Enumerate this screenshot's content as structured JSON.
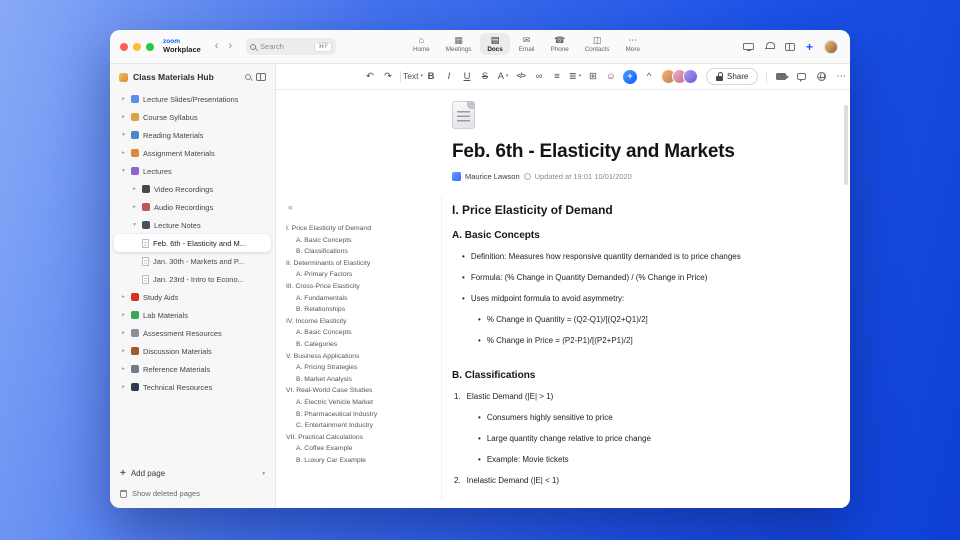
{
  "icons": {
    "back": "‹",
    "forward": "›",
    "home_tab": "⌂",
    "meetings_tab": "▦",
    "docs_tab": "▤",
    "email_tab": "✉",
    "phone_tab": "☎",
    "contacts_tab": "◫",
    "more_tab": "⋯",
    "undo": "↶",
    "redo": "↷",
    "bold": "B",
    "italic": "I",
    "underline": "U",
    "strikethrough": "S",
    "text_color": "A",
    "code": "</>",
    "link": "∞",
    "bulleted_list": "≡",
    "align": "≣",
    "table": "⊞",
    "emoji": "☺",
    "chevron_down": "▾",
    "chevron_up": "^",
    "collapse_outline": "«",
    "more": "⋯",
    "add": "+",
    "plus_new": "+",
    "bullet": "•",
    "tree_expanded": "▾",
    "tree_collapsed": "▸"
  },
  "header": {
    "brand_top": "zoom",
    "brand_bottom": "Workplace",
    "search_label": "Search",
    "search_shortcut": "⌘F",
    "tabs": [
      {
        "id": "home",
        "label": "Home",
        "active": false
      },
      {
        "id": "meetings",
        "label": "Meetings",
        "active": false
      },
      {
        "id": "docs",
        "label": "Docs",
        "active": true
      },
      {
        "id": "email",
        "label": "Email",
        "active": false
      },
      {
        "id": "phone",
        "label": "Phone",
        "active": false
      },
      {
        "id": "contacts",
        "label": "Contacts",
        "active": false
      },
      {
        "id": "more",
        "label": "More",
        "active": false
      }
    ]
  },
  "sidebar": {
    "title": "Class Materials Hub",
    "items": [
      {
        "label": "Lecture Slides/Presentations",
        "level": 0,
        "state": "collapsed",
        "color": "#5b8def"
      },
      {
        "label": "Course Syllabus",
        "level": 0,
        "state": "collapsed",
        "color": "#d9a441"
      },
      {
        "label": "Reading Materials",
        "level": 0,
        "state": "expanded",
        "color": "#4c86c6"
      },
      {
        "label": "Assignment Materials",
        "level": 0,
        "state": "collapsed",
        "color": "#d8893b"
      },
      {
        "label": "Lectures",
        "level": 0,
        "state": "expanded",
        "color": "#8e63ce"
      },
      {
        "label": "Video Recordings",
        "level": 1,
        "state": "collapsed",
        "color": "#45484d"
      },
      {
        "label": "Audio Recordings",
        "level": 1,
        "state": "collapsed",
        "color": "#c0574f"
      },
      {
        "label": "Lecture Notes",
        "level": 1,
        "state": "expanded",
        "color": "#46525e"
      },
      {
        "label": "Feb. 6th - Elasticity and M...",
        "level": 2,
        "state": "page",
        "selected": true
      },
      {
        "label": "Jan. 30th - Markets and P...",
        "level": 2,
        "state": "page",
        "selected": false
      },
      {
        "label": "Jan. 23rd - Intro to Econo...",
        "level": 2,
        "state": "page",
        "selected": false
      },
      {
        "label": "Study Aids",
        "level": 0,
        "state": "collapsed",
        "color": "#d93025"
      },
      {
        "label": "Lab Materials",
        "level": 0,
        "state": "collapsed",
        "color": "#3aa757"
      },
      {
        "label": "Assessment Resources",
        "level": 0,
        "state": "collapsed",
        "color": "#8a8f98"
      },
      {
        "label": "Discussion Materials",
        "level": 0,
        "state": "collapsed",
        "color": "#a05a2c"
      },
      {
        "label": "Reference Materials",
        "level": 0,
        "state": "collapsed",
        "color": "#6d7b8d"
      },
      {
        "label": "Technical Resources",
        "level": 0,
        "state": "collapsed",
        "color": "#2f3b4c"
      }
    ],
    "add_page_label": "Add page",
    "show_deleted_label": "Show deleted pages"
  },
  "toolbar": {
    "text_style_label": "Text",
    "share_label": "Share"
  },
  "document": {
    "title": "Feb. 6th - Elasticity and Markets",
    "author": "Maurice Lawson",
    "updated": "Updated at 19:01 10/01/2020",
    "outline": [
      {
        "text": "I. Price Elasticity of Demand",
        "level": 0
      },
      {
        "text": "A. Basic Concepts",
        "level": 1
      },
      {
        "text": "B. Classifications",
        "level": 1
      },
      {
        "text": "II. Determinants of Elasticity",
        "level": 0
      },
      {
        "text": "A. Primary Factors",
        "level": 1
      },
      {
        "text": "III. Cross-Price Elasticity",
        "level": 0
      },
      {
        "text": "A. Fundamentals",
        "level": 1
      },
      {
        "text": "B. Relationships",
        "level": 1
      },
      {
        "text": "IV. Income Elasticity",
        "level": 0
      },
      {
        "text": "A. Basic Concepts",
        "level": 1
      },
      {
        "text": "B. Categories",
        "level": 1
      },
      {
        "text": "V. Business Applications",
        "level": 0
      },
      {
        "text": "A. Pricing Strategies",
        "level": 1
      },
      {
        "text": "B. Market Analysis",
        "level": 1
      },
      {
        "text": "VI. Real-World Case Studies",
        "level": 0
      },
      {
        "text": "A. Electric Vehicle Market",
        "level": 1
      },
      {
        "text": "B. Pharmaceutical Industry",
        "level": 1
      },
      {
        "text": "C. Entertainment Industry",
        "level": 1
      },
      {
        "text": "VII. Practical Calculations",
        "level": 0
      },
      {
        "text": "A. Coffee Example",
        "level": 1
      },
      {
        "text": "B. Luxury Car Example",
        "level": 1
      }
    ],
    "blocks": [
      {
        "type": "h2",
        "text": "I. Price Elasticity of Demand"
      },
      {
        "type": "h3",
        "text": "A. Basic Concepts"
      },
      {
        "type": "bullet",
        "level": 0,
        "text": "Definition: Measures how responsive quantity demanded is to price changes"
      },
      {
        "type": "bullet",
        "level": 0,
        "text": "Formula: (% Change in Quantity Demanded) / (% Change in Price)"
      },
      {
        "type": "bullet",
        "level": 0,
        "text": "Uses midpoint formula to avoid asymmetry:"
      },
      {
        "type": "bullet",
        "level": 1,
        "text": "% Change in Quantity = (Q2-Q1)/[(Q2+Q1)/2]"
      },
      {
        "type": "bullet",
        "level": 1,
        "text": "% Change in Price = (P2-P1)/[(P2+P1)/2]"
      },
      {
        "type": "h3",
        "text": "B. Classifications"
      },
      {
        "type": "number",
        "marker": "1.",
        "text": "Elastic Demand (|E| > 1)"
      },
      {
        "type": "bullet",
        "level": 1,
        "text": "Consumers highly sensitive to price"
      },
      {
        "type": "bullet",
        "level": 1,
        "text": "Large quantity change relative to price change"
      },
      {
        "type": "bullet",
        "level": 1,
        "text": "Example: Movie tickets"
      },
      {
        "type": "number",
        "marker": "2.",
        "text": "Inelastic Demand (|E| < 1)"
      }
    ]
  }
}
